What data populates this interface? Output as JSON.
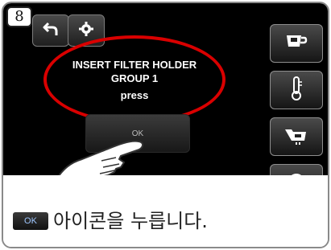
{
  "step": {
    "number": "8"
  },
  "toolbar": {
    "back_icon": "back-arrow-icon",
    "settings_icon": "gear-icon"
  },
  "dialog": {
    "line1": "INSERT FILTER HOLDER",
    "line2": "GROUP 1",
    "line3": "press",
    "highlight_color": "#d90000"
  },
  "ok_button": {
    "label": "OK"
  },
  "side_buttons": [
    {
      "icon": "cup-icon"
    },
    {
      "icon": "thermometer-icon"
    },
    {
      "icon": "filter-holder-icon"
    },
    {
      "icon": "timer-icon"
    }
  ],
  "caption": {
    "chip_label": "OK",
    "text": "아이콘을 누릅니다."
  }
}
